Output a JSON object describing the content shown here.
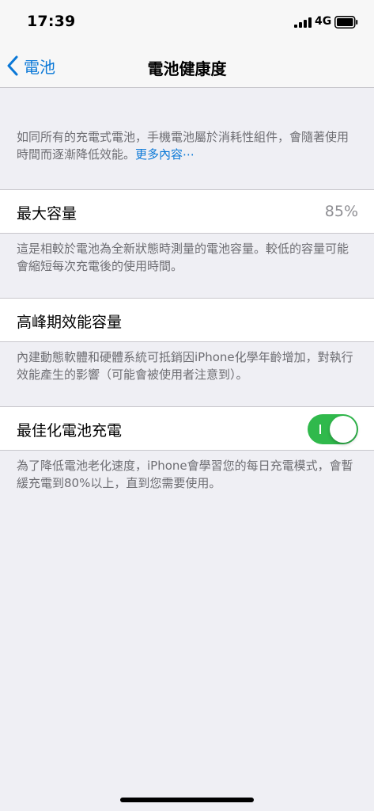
{
  "status_bar": {
    "time": "17:39",
    "network": "4G",
    "icons": [
      "cellular-signal-icon",
      "battery-icon"
    ]
  },
  "nav": {
    "back_label": "電池",
    "title": "電池健康度"
  },
  "intro": {
    "text": "如同所有的充電式電池，手機電池屬於消耗性組件，會隨著使用時間而逐漸降低效能。",
    "link": "更多內容⋯"
  },
  "max_capacity": {
    "label": "最大容量",
    "value": "85%",
    "footnote": "這是相較於電池為全新狀態時測量的電池容量。較低的容量可能會縮短每次充電後的使用時間。"
  },
  "peak_performance": {
    "label": "高峰期效能容量",
    "footnote": "內建動態軟體和硬體系統可抵銷因iPhone化學年齡增加，對執行效能產生的影響（可能會被使用者注意到）。"
  },
  "optimized_charging": {
    "label": "最佳化電池充電",
    "enabled": true,
    "footnote": "為了降低電池老化速度，iPhone會學習您的每日充電模式，會暫緩充電到80%以上，直到您需要使用。"
  },
  "colors": {
    "accent": "#0a78d7",
    "toggle_on": "#30b94c",
    "background": "#efeff4",
    "secondary_text": "#6d6d72"
  }
}
